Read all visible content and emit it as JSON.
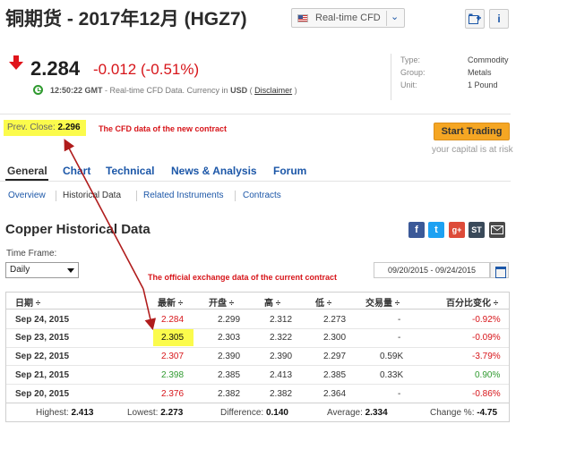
{
  "header": {
    "title": "铜期货 - 2017年12月 (HGZ7)",
    "cfd_selector": "Real-time CFD"
  },
  "quote": {
    "price": "2.284",
    "change": "-0.012",
    "change_pct": "(-0.51%)",
    "time": "12:50:22 GMT",
    "desc": " - Real-time CFD Data. Currency in ",
    "currency": "USD",
    "paren_open": " ( ",
    "disclaimer": "Disclaimer",
    "paren_close": " )"
  },
  "meta": [
    {
      "key": "Type:",
      "value": "Commodity"
    },
    {
      "key": "Group:",
      "value": "Metals"
    },
    {
      "key": "Unit:",
      "value": "1 Pound"
    }
  ],
  "prev_close": {
    "label": "Prev. Close: ",
    "value": "2.296"
  },
  "annotations": {
    "cfd_note": "The CFD data of the new contract",
    "exchange_note": "The official exchange data of the current contract"
  },
  "start_trading": "Start Trading",
  "capital_risk": "your capital is at risk",
  "tabs": [
    "General",
    "Chart",
    "Technical",
    "News & Analysis",
    "Forum"
  ],
  "subtabs": [
    "Overview",
    "Historical Data",
    "Related Instruments",
    "Contracts"
  ],
  "section_title": "Copper Historical Data",
  "timeframe": {
    "label": "Time Frame:",
    "value": "Daily"
  },
  "date_range": "09/20/2015 - 09/24/2015",
  "table": {
    "headers": [
      "日期 ÷",
      "最新 ÷",
      "开盘 ÷",
      "高 ÷",
      "低 ÷",
      "交易量 ÷",
      "百分比变化 ÷"
    ],
    "rows": [
      {
        "date": "Sep 24, 2015",
        "last": "2.284",
        "open": "2.299",
        "high": "2.312",
        "low": "2.273",
        "vol": "-",
        "chg": "-0.92%"
      },
      {
        "date": "Sep 23, 2015",
        "last": "2.305",
        "open": "2.303",
        "high": "2.322",
        "low": "2.300",
        "vol": "-",
        "chg": "-0.09%"
      },
      {
        "date": "Sep 22, 2015",
        "last": "2.307",
        "open": "2.390",
        "high": "2.390",
        "low": "2.297",
        "vol": "0.59K",
        "chg": "-3.79%"
      },
      {
        "date": "Sep 21, 2015",
        "last": "2.398",
        "open": "2.385",
        "high": "2.413",
        "low": "2.385",
        "vol": "0.33K",
        "chg": "0.90%"
      },
      {
        "date": "Sep 20, 2015",
        "last": "2.376",
        "open": "2.382",
        "high": "2.382",
        "low": "2.364",
        "vol": "-",
        "chg": "-0.86%"
      }
    ]
  },
  "summary": {
    "highest_label": "Highest: ",
    "highest": "2.413",
    "lowest_label": "Lowest: ",
    "lowest": "2.273",
    "difference_label": "Difference: ",
    "difference": "0.140",
    "average_label": "Average: ",
    "average": "2.334",
    "change_label": "Change %: ",
    "change": "-4.75"
  },
  "colors": {
    "negative": "#d7151a",
    "positive": "#2f9a2f",
    "link": "#1c57a8",
    "highlight": "#fbfb4c",
    "button": "#f5a623"
  }
}
